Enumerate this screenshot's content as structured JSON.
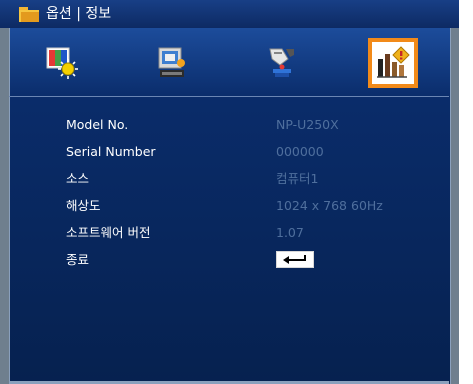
{
  "window": {
    "title": "옵션 | 정보"
  },
  "tabs": [
    {
      "name": "image-settings-icon",
      "active": false
    },
    {
      "name": "display-settings-icon",
      "active": false
    },
    {
      "name": "setup-icon",
      "active": false
    },
    {
      "name": "information-icon",
      "active": true
    }
  ],
  "info": {
    "rows": [
      {
        "label": "Model No.",
        "value": "NP-U250X"
      },
      {
        "label": "Serial Number",
        "value": "000000"
      },
      {
        "label": "소스",
        "value": "컴퓨터1"
      },
      {
        "label": "해상도",
        "value": "1024 x 768  60Hz"
      },
      {
        "label": "소프트웨어 버전",
        "value": "1.07"
      },
      {
        "label": "종료",
        "value": ""
      }
    ],
    "exit_icon": "enter-return-icon"
  },
  "colors": {
    "title_bar": "#183f86",
    "panel_top": "#1c4c9b",
    "panel_bottom": "#06214f",
    "active_tab_border": "#f28a19",
    "value_text": "#4f6f9d",
    "label_text": "#ffffff"
  }
}
